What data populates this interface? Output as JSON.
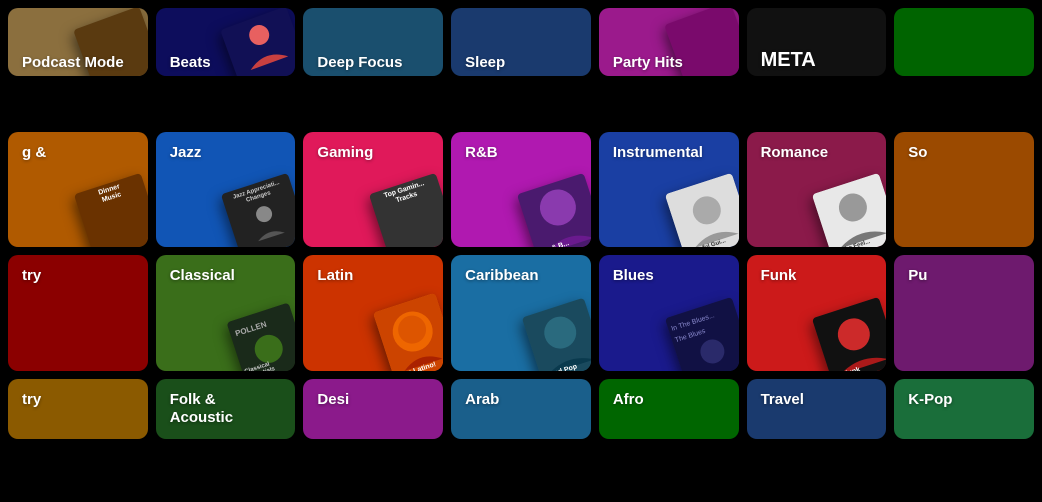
{
  "grid": {
    "rows": [
      {
        "id": "row1",
        "partial": "top",
        "cells": [
          {
            "id": "podcast",
            "label": "",
            "sublabel": "Podcast Mode",
            "bg": "#8b6f3e",
            "albumBg": "#5a4520",
            "albumText": "",
            "hasAlbum": false
          },
          {
            "id": "beats",
            "label": "",
            "sublabel": "Beats",
            "bg": "#1a1a6e",
            "albumBg": "#0a0a4e",
            "albumText": "",
            "hasAlbum": false
          },
          {
            "id": "focus",
            "label": "",
            "sublabel": "Deep Focus",
            "bg": "#1a4f6e",
            "albumBg": "#0a3050",
            "albumText": "",
            "hasAlbum": false
          },
          {
            "id": "sleep",
            "label": "",
            "sublabel": "Sleep",
            "bg": "#1a3a6e",
            "albumBg": "#0a2050",
            "albumText": "",
            "hasAlbum": false
          },
          {
            "id": "party",
            "label": "",
            "sublabel": "Party Hits",
            "bg": "#9b1a8c",
            "albumBg": "#7a0a6c",
            "albumText": "",
            "hasAlbum": false
          },
          {
            "id": "meta",
            "label": "",
            "sublabel": "META",
            "bg": "#1a1a1a",
            "albumBg": "#111",
            "albumText": "META",
            "hasAlbum": false
          },
          {
            "id": "right1",
            "label": "",
            "sublabel": "",
            "bg": "#006400",
            "albumBg": "#004400",
            "albumText": "",
            "hasAlbum": false
          }
        ]
      },
      {
        "id": "row2",
        "partial": "none",
        "cells": [
          {
            "id": "dinner",
            "label": "& ",
            "sublabel": "Dinner Music",
            "bg": "#b05a00",
            "albumBg": "#7a3a00",
            "albumText": "Dinner Music",
            "hasAlbum": true
          },
          {
            "id": "jazz",
            "label": "Jazz",
            "sublabel": "",
            "bg": "#1155b5",
            "albumBg": "#222",
            "albumText": "Jazz Appreciati... Changes",
            "hasAlbum": true
          },
          {
            "id": "gaming",
            "label": "Gaming",
            "sublabel": "",
            "bg": "#e0195a",
            "albumBg": "#333",
            "albumText": "Top Gamin... Tracks",
            "hasAlbum": true
          },
          {
            "id": "rnb",
            "label": "R&B",
            "sublabel": "",
            "bg": "#b019b0",
            "albumBg": "#4a1a6e",
            "albumText": "are & B...",
            "hasAlbum": true
          },
          {
            "id": "instrumental",
            "label": "Instrumental",
            "sublabel": "",
            "bg": "#1a3fa3",
            "albumBg": "#1a3a6e",
            "albumText": "Peaceful Gui...",
            "hasAlbum": true
          },
          {
            "id": "romance",
            "label": "Romance",
            "sublabel": "",
            "bg": "#8b1a4a",
            "albumBg": "#eee",
            "albumText": "All The Feel...",
            "hasAlbum": true
          },
          {
            "id": "so",
            "label": "So",
            "sublabel": "",
            "bg": "#9b4a00",
            "albumBg": "#7a3000",
            "albumText": "",
            "hasAlbum": false
          }
        ]
      },
      {
        "id": "row3",
        "partial": "none",
        "cells": [
          {
            "id": "country2",
            "label": "try",
            "sublabel": "",
            "bg": "#8b0000",
            "albumBg": "#5a0000",
            "albumText": "",
            "hasAlbum": false
          },
          {
            "id": "classical",
            "label": "Classical",
            "sublabel": "",
            "bg": "#3a6e1a",
            "albumBg": "#1a2a1a",
            "albumText": "POLLEN",
            "hasAlbum": true,
            "albumText2": "Classical Essentials"
          },
          {
            "id": "latin",
            "label": "Latin",
            "sublabel": "",
            "bg": "#cc3300",
            "albumBg": "#ee6600",
            "albumText": "¡Viva Latino!",
            "hasAlbum": true
          },
          {
            "id": "caribbean",
            "label": "Caribbean",
            "sublabel": "",
            "bg": "#1a6ea3",
            "albumBg": "#1a5a6e",
            "albumText": "Island Pop",
            "hasAlbum": true
          },
          {
            "id": "blues",
            "label": "Blues",
            "sublabel": "",
            "bg": "#1a1a8c",
            "albumBg": "#1a1a5a",
            "albumText": "In The Blues... The Blues",
            "hasAlbum": true
          },
          {
            "id": "funk",
            "label": "Funk",
            "sublabel": "",
            "bg": "#cc1a1a",
            "albumBg": "#222",
            "albumText": "Nu Funk",
            "hasAlbum": true
          },
          {
            "id": "pu",
            "label": "Pu",
            "sublabel": "",
            "bg": "#6e1a6e",
            "albumBg": "#5a0a5a",
            "albumText": "",
            "hasAlbum": false
          }
        ]
      },
      {
        "id": "row4",
        "partial": "bottom",
        "cells": [
          {
            "id": "try2",
            "label": "try",
            "sublabel": "",
            "bg": "#8b5a00",
            "albumBg": "#5a3a00",
            "albumText": "",
            "hasAlbum": false
          },
          {
            "id": "folk",
            "label": "Folk &\nAcoustic",
            "sublabel": "",
            "bg": "#1a4f1a",
            "albumBg": "#0a3010",
            "albumText": "",
            "hasAlbum": false
          },
          {
            "id": "desi",
            "label": "Desi",
            "sublabel": "",
            "bg": "#8b1a8b",
            "albumBg": "#5a0a5a",
            "albumText": "",
            "hasAlbum": false
          },
          {
            "id": "arab",
            "label": "Arab",
            "sublabel": "",
            "bg": "#1a5f8b",
            "albumBg": "#0a3060",
            "albumText": "",
            "hasAlbum": false
          },
          {
            "id": "afro",
            "label": "Afro",
            "sublabel": "",
            "bg": "#006600",
            "albumBg": "#004400",
            "albumText": "",
            "hasAlbum": false
          },
          {
            "id": "travel",
            "label": "Travel",
            "sublabel": "",
            "bg": "#1a3a6e",
            "albumBg": "#0a2050",
            "albumText": "",
            "hasAlbum": false
          },
          {
            "id": "kpop",
            "label": "K-Pop",
            "sublabel": "",
            "bg": "#1a6e3a",
            "albumBg": "#0a4a20",
            "albumText": "",
            "hasAlbum": false
          }
        ]
      }
    ]
  }
}
